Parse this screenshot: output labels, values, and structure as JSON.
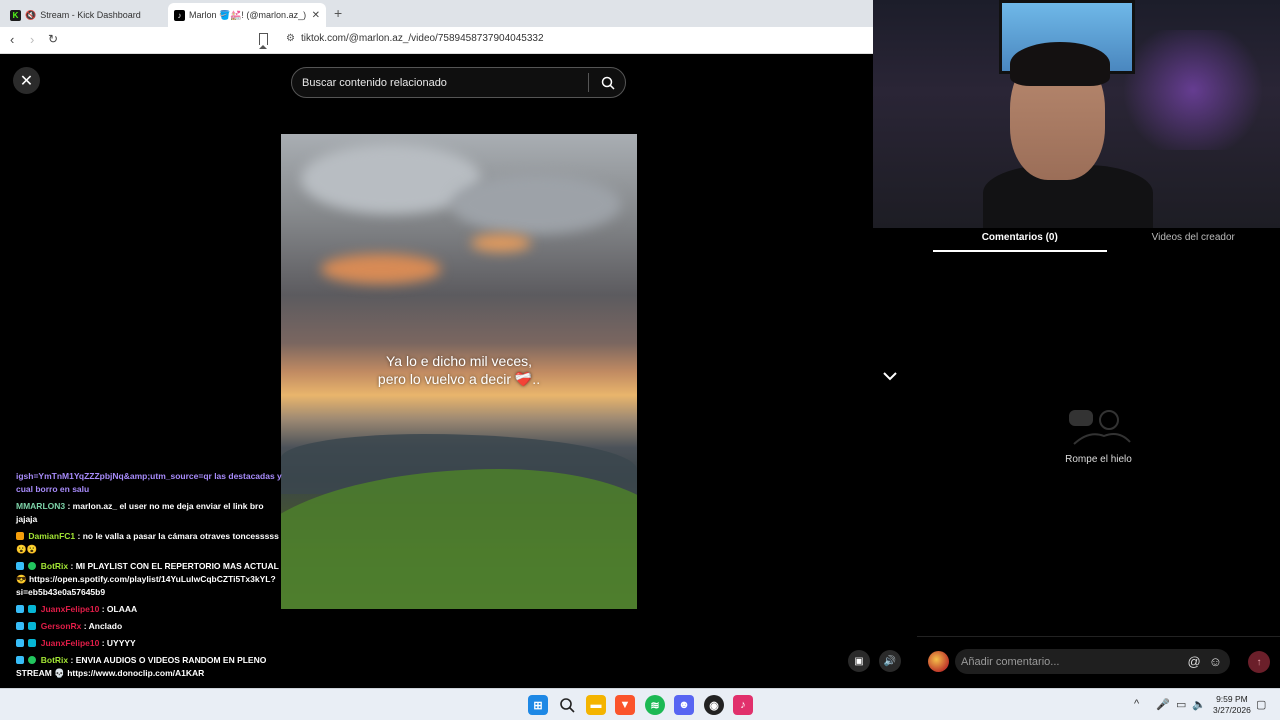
{
  "browser": {
    "tabs": [
      {
        "title": "Stream - Kick Dashboard",
        "muted": true
      },
      {
        "title": "Marlon 🪣💒! (@marlon.az_) | T"
      }
    ],
    "url": "tiktok.com/@marlon.az_/video/7589458737904045332"
  },
  "tiktok": {
    "search_placeholder": "Buscar contenido relacionado",
    "video_caption_line1": "Ya lo e dicho mil veces,",
    "video_caption_line2": "pero lo vuelvo a decir ❤️‍🩹..",
    "comments_tab": "Comentarios (0)",
    "creator_videos_tab": "Videos del creador",
    "empty_comments_text": "Rompe el hielo",
    "comment_placeholder": "Añadir comentario..."
  },
  "chat": {
    "messages": [
      {
        "user": "",
        "text": "igsh=YmTnM1YqZZZpbjNq&amp;utm_source=qr las destacadas y cual borro en salu",
        "color": "#a78bfa"
      },
      {
        "user": "MMARLON3",
        "text": ": marlon.az_ el user no me deja enviar el link bro jajaja",
        "color": "#7dd3a8"
      },
      {
        "user": "DamianFC1",
        "text": ": no le valla a pasar la cámara otraves toncesssss 😮😮",
        "color": "#a3e635"
      },
      {
        "user": "BotRix",
        "text": ": MI PLAYLIST CON EL REPERTORIO MAS ACTUAL 😎 https://open.spotify.com/playlist/14YuLulwCqbCZTi5Tx3kYL?si=eb5b43e0a57645b9",
        "color": "#a3e635"
      },
      {
        "user": "JuanxFelipe10",
        "text": ": OLAAA",
        "color": "#e11d48"
      },
      {
        "user": "GersonRx",
        "text": ": Anclado",
        "color": "#e11d48"
      },
      {
        "user": "JuanxFelipe10",
        "text": ": UYYYY",
        "color": "#e11d48"
      },
      {
        "user": "BotRix",
        "text": ": ENVIA AUDIOS O VIDEOS RANDOM EN PLENO STREAM 💀 https://www.donoclip.com/A1KAR",
        "color": "#a3e635"
      }
    ]
  },
  "taskbar": {
    "time": "9:59 PM",
    "date": "3/27/2026"
  }
}
